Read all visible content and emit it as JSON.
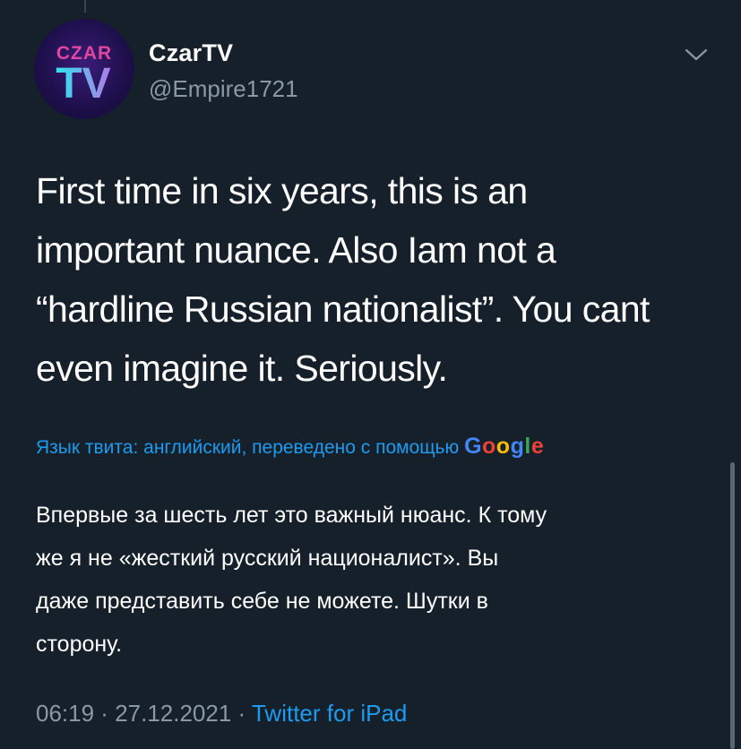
{
  "tweet": {
    "author": {
      "display_name": "CzarTV",
      "handle": "@Empire1721",
      "avatar": {
        "icon": "czartv-logo",
        "logo_text_top": "CZAR",
        "logo_text_bottom": "TV"
      }
    },
    "text": "First time in six years, this is an\nimportant nuance. Also Iam not a\n“hardline Russian nationalist”. You cant\neven imagine it. Seriously.",
    "translation": {
      "label": "Язык твита: английский, переведено с помощью ",
      "provider": "Google",
      "provider_letters": [
        "G",
        "o",
        "o",
        "g",
        "l",
        "e"
      ],
      "text": "Впервые за шесть лет это важный нюанс. К тому\nже я не «жесткий русский националист». Вы\nдаже представить себе не можете. Шутки в\nсторону."
    },
    "time": "06:19",
    "separator": " · ",
    "date": "27.12.2021",
    "source": "Twitter for iPad",
    "menu_icon": "chevron-down-icon"
  },
  "colors": {
    "background": "#15202b",
    "text": "#ffffff",
    "secondary_text": "#8b98a5",
    "accent": "#1d9bf0",
    "avatar_bg": "#1d0f4a",
    "logo_cyan": "#2ee6f0",
    "logo_pink": "#e0479e"
  }
}
